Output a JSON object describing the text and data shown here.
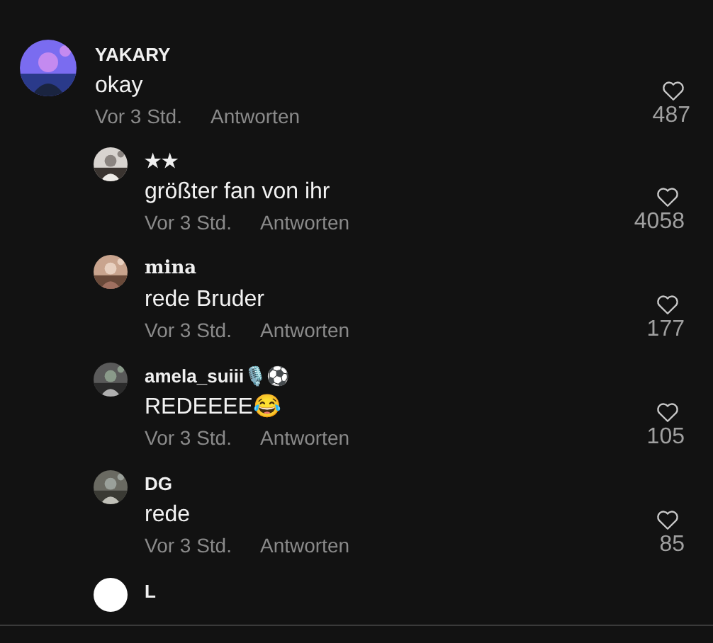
{
  "comments": [
    {
      "name": "YAKARY",
      "fancy_name": false,
      "text": "okay",
      "time": "Vor 3 Std.",
      "reply": "Antworten",
      "likes": "487",
      "replies": [
        {
          "name": "★★",
          "fancy_name": false,
          "text": "größter fan von ihr",
          "time": "Vor 3 Std.",
          "reply": "Antworten",
          "likes": "4058"
        },
        {
          "name": "mina",
          "fancy_name": true,
          "text": "rede Bruder",
          "time": "Vor 3 Std.",
          "reply": "Antworten",
          "likes": "177"
        },
        {
          "name": "amela_suiii🎙️⚽",
          "fancy_name": false,
          "text": "REDEEEE😂",
          "time": "Vor 3 Std.",
          "reply": "Antworten",
          "likes": "105"
        },
        {
          "name": "DG",
          "fancy_name": false,
          "text": "rede",
          "time": "Vor 3 Std.",
          "reply": "Antworten",
          "likes": "85"
        },
        {
          "avatar": {
            "kind": "plain"
          },
          "name": "L",
          "fancy_name": false
        }
      ]
    }
  ]
}
